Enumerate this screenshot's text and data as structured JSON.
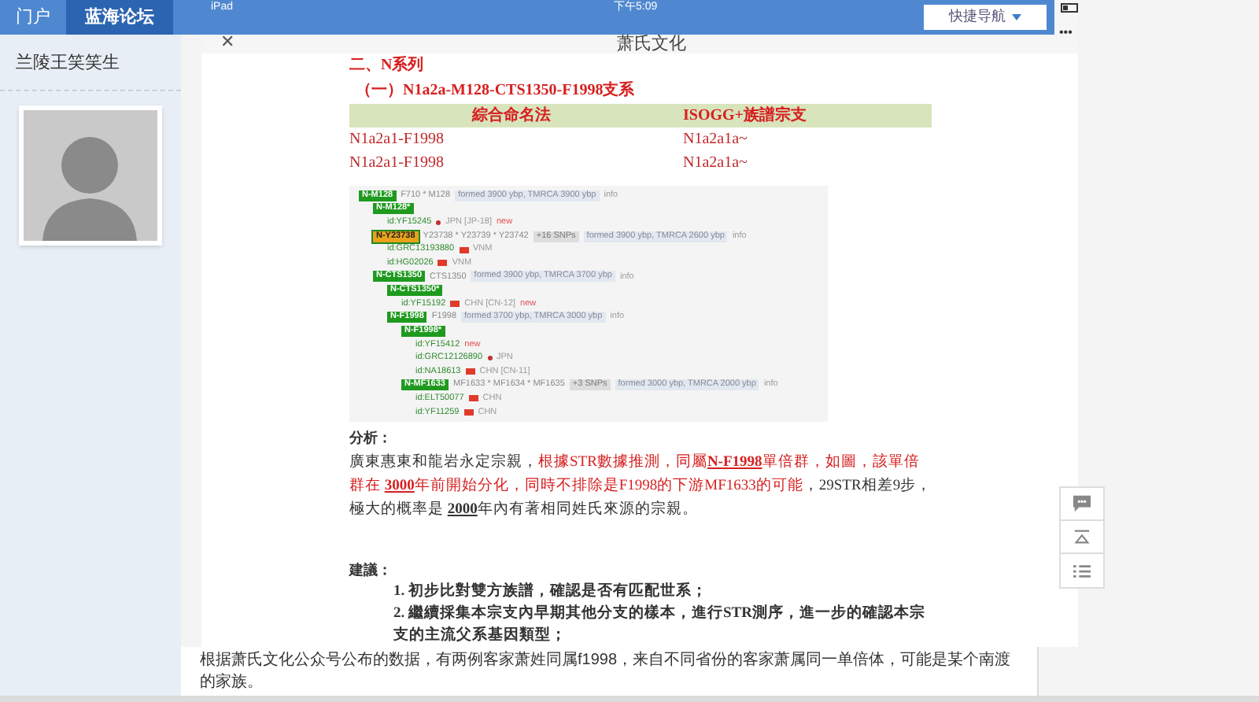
{
  "nav": {
    "tabs": [
      {
        "label": "门户",
        "selected": false
      },
      {
        "label": "蓝海论坛",
        "selected": true
      }
    ],
    "quick_nav": "快捷导航"
  },
  "sidebar": {
    "username": "兰陵王笑笑生"
  },
  "article_image": {
    "status_bar": {
      "device": "iPad",
      "time": "下午5:09"
    },
    "close_glyph": "✕",
    "title": "萧氏文化",
    "more_glyph": "•••",
    "heading": "二、N系列",
    "subheading": "（一）N1a2a-M128-CTS1350-F1998支系",
    "table": {
      "columns": [
        "綜合命名法",
        "ISOGG+族譜宗支"
      ],
      "rows": [
        [
          "N1a2a1-F1998",
          "N1a2a1a~"
        ],
        [
          "N1a2a1-F1998",
          "N1a2a1a~"
        ]
      ]
    },
    "tree": [
      {
        "kind": "node",
        "label": "N-M128",
        "highlighted": false,
        "snps": "F710 * M128",
        "age": "formed 3900 ybp, TMRCA 3900 ybp",
        "link": "info",
        "children": [
          {
            "kind": "node",
            "label": "N-M128*",
            "highlighted": false,
            "children": [
              {
                "kind": "sample",
                "id": "id:YF15245",
                "flag": false,
                "dot": true,
                "country": "JPN [JP-18]",
                "tag": "new"
              }
            ]
          },
          {
            "kind": "node",
            "label": "N-Y23738",
            "highlighted": true,
            "snps": "Y23738 * Y23739 * Y23742",
            "extra": "+16 SNPs",
            "age": "formed 3900 ybp, TMRCA 2600 ybp",
            "link": "info",
            "children": [
              {
                "kind": "sample",
                "id": "id:GRC13193880",
                "flag": true,
                "dot": false,
                "country": "VNM"
              },
              {
                "kind": "sample",
                "id": "id:HG02026",
                "flag": true,
                "dot": false,
                "country": "VNM"
              }
            ]
          },
          {
            "kind": "node",
            "label": "N-CTS1350",
            "highlighted": false,
            "snps": "CTS1350",
            "age": "formed 3900 ybp, TMRCA 3700 ybp",
            "link": "info",
            "children": [
              {
                "kind": "node",
                "label": "N-CTS1350*",
                "highlighted": false,
                "children": [
                  {
                    "kind": "sample",
                    "id": "id:YF15192",
                    "flag": true,
                    "dot": false,
                    "country": "CHN [CN-12]",
                    "tag": "new"
                  }
                ]
              },
              {
                "kind": "node",
                "label": "N-F1998",
                "highlighted": false,
                "snps": "F1998",
                "age": "formed 3700 ybp, TMRCA 3000 ybp",
                "link": "info",
                "children": [
                  {
                    "kind": "node",
                    "label": "N-F1998*",
                    "highlighted": false,
                    "children": [
                      {
                        "kind": "sample",
                        "id": "id:YF15412",
                        "flag": false,
                        "dot": false,
                        "tag": "new"
                      },
                      {
                        "kind": "sample",
                        "id": "id:GRC12126890",
                        "flag": false,
                        "dot": true,
                        "country": "JPN"
                      },
                      {
                        "kind": "sample",
                        "id": "id:NA18613",
                        "flag": true,
                        "dot": false,
                        "country": "CHN [CN-11]"
                      }
                    ]
                  },
                  {
                    "kind": "node",
                    "label": "N-MF1633",
                    "highlighted": false,
                    "snps": "MF1633 * MF1634 * MF1635",
                    "extra": "+3 SNPs",
                    "age": "formed 3000 ybp, TMRCA 2000 ybp",
                    "link": "info",
                    "children": [
                      {
                        "kind": "sample",
                        "id": "id:ELT50077",
                        "flag": true,
                        "dot": false,
                        "country": "CHN"
                      },
                      {
                        "kind": "sample",
                        "id": "id:YF11259",
                        "flag": true,
                        "dot": false,
                        "country": "CHN"
                      }
                    ]
                  }
                ]
              }
            ]
          }
        ]
      }
    ],
    "analysis_label": "分析：",
    "analysis": [
      {
        "text": "廣東惠東和龍岩永定宗親，",
        "emphasis": false
      },
      {
        "text": "根據STR數據推測，同屬**N-F1998**單倍群，如圖，該單倍群在 **3000**年前開始分化，同時不排除是F1998的下游MF1633的可能",
        "emphasis": true
      },
      {
        "text": "，29STR相差9步，極大的概率是 **2000**年內有著相同姓氏來源的宗親。",
        "emphasis": false
      }
    ],
    "advice_label": "建議：",
    "advice": [
      "1. 初步比對雙方族譜，確認是否有匹配世系；",
      "2. 繼續採集本宗支內早期其他分支的樣本，進行STR測序，進一步的確認本宗支的主流父系基因類型；"
    ]
  },
  "post_text": "根据萧氏文化公众号公布的数据，有两例客家萧姓同属f1998，来自不同省份的客家萧属同一单倍体，可能是某个南渡的家族。"
}
